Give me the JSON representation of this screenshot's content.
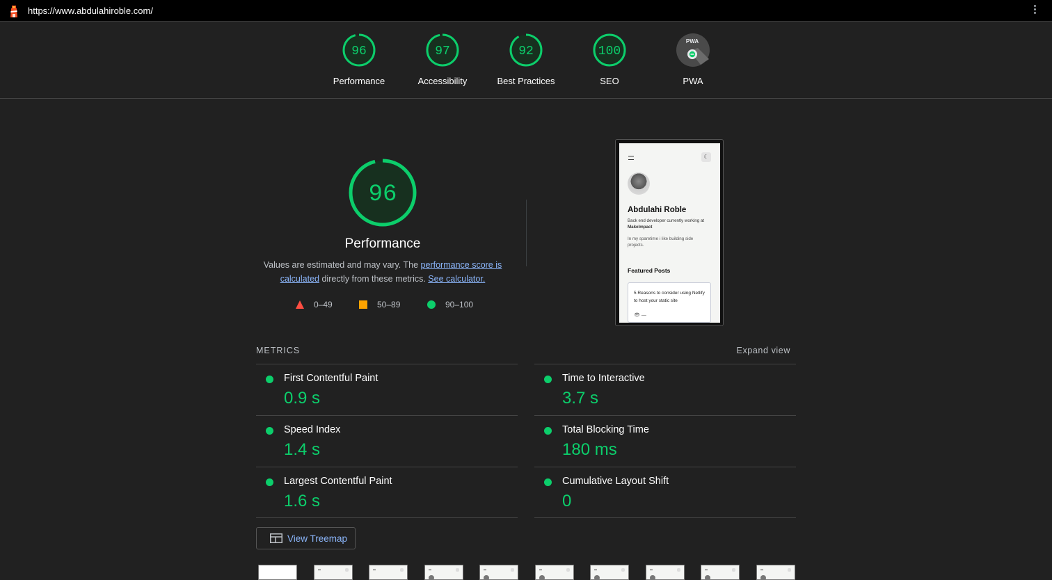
{
  "topbar": {
    "url": "https://www.abdulahiroble.com/"
  },
  "colors": {
    "pass": "#0cce6b",
    "average": "#ffa400",
    "fail": "#ff4e42",
    "link": "#8ab4f8",
    "background": "#212121"
  },
  "categories": [
    {
      "score": "96",
      "label": "Performance",
      "value": 96
    },
    {
      "score": "97",
      "label": "Accessibility",
      "value": 97
    },
    {
      "score": "92",
      "label": "Best Practices",
      "value": 92
    },
    {
      "score": "100",
      "label": "SEO",
      "value": 100
    },
    {
      "score": "PWA",
      "label": "PWA",
      "icon": "pwa-badge-icon"
    }
  ],
  "performance": {
    "score": "96",
    "value": 96,
    "title": "Performance",
    "desc_prefix": "Values are estimated and may vary. The ",
    "desc_link1": "performance score is calculated",
    "desc_middle": " directly from these metrics. ",
    "desc_link2": "See calculator."
  },
  "legend": [
    {
      "range": "0–49",
      "shape": "triangle"
    },
    {
      "range": "50–89",
      "shape": "square"
    },
    {
      "range": "90–100",
      "shape": "circle"
    }
  ],
  "screenshot": {
    "name": "Abdulahi Roble",
    "bio_prefix": "Back end developer currently working at ",
    "bio_company": "MakeImpact",
    "bio2": "In my sparetime i like building side projects.",
    "featured": "Featured Posts",
    "card_title": "5 Reasons to consider using Netlify to host your static site",
    "card_meta": "—"
  },
  "metrics": {
    "heading": "METRICS",
    "expand": "Expand view",
    "items": [
      {
        "name": "First Contentful Paint",
        "value": "0.9 s"
      },
      {
        "name": "Time to Interactive",
        "value": "3.7 s"
      },
      {
        "name": "Speed Index",
        "value": "1.4 s"
      },
      {
        "name": "Total Blocking Time",
        "value": "180 ms"
      },
      {
        "name": "Largest Contentful Paint",
        "value": "1.6 s"
      },
      {
        "name": "Cumulative Layout Shift",
        "value": "0"
      }
    ]
  },
  "treemap": {
    "label": "View Treemap",
    "icon": "treemap-icon"
  }
}
